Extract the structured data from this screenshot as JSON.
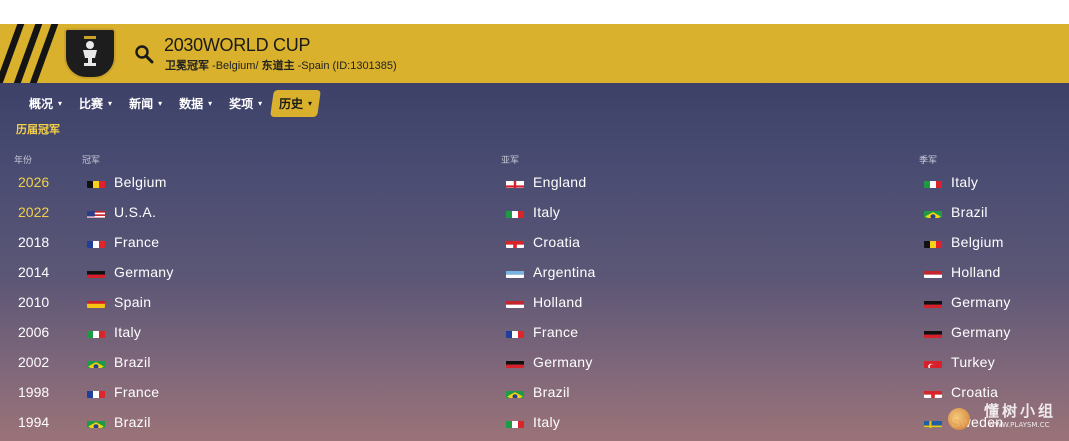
{
  "header": {
    "title": "2030WORLD CUP",
    "subtitle_label1": "卫冕冠军",
    "subtitle_value1": " -Belgium/ ",
    "subtitle_label2": "东道主",
    "subtitle_value2": " -Spain (ID:1301385)"
  },
  "nav": [
    {
      "label": "概况",
      "active": false
    },
    {
      "label": "比赛",
      "active": false
    },
    {
      "label": "新闻",
      "active": false
    },
    {
      "label": "数据",
      "active": false
    },
    {
      "label": "奖项",
      "active": false
    },
    {
      "label": "历史",
      "active": true
    }
  ],
  "section_title": "历届冠军",
  "columns": {
    "year": "年份",
    "champion": "冠军",
    "runner_up": "亚军",
    "third": "季军"
  },
  "rows": [
    {
      "year": "2026",
      "highlight": true,
      "champion": {
        "name": "Belgium",
        "flag": "be"
      },
      "runner_up": {
        "name": "England",
        "flag": "en"
      },
      "third": {
        "name": "Italy",
        "flag": "it"
      }
    },
    {
      "year": "2022",
      "highlight": true,
      "champion": {
        "name": "U.S.A.",
        "flag": "us"
      },
      "runner_up": {
        "name": "Italy",
        "flag": "it"
      },
      "third": {
        "name": "Brazil",
        "flag": "br"
      }
    },
    {
      "year": "2018",
      "highlight": false,
      "champion": {
        "name": "France",
        "flag": "fr"
      },
      "runner_up": {
        "name": "Croatia",
        "flag": "hr"
      },
      "third": {
        "name": "Belgium",
        "flag": "be"
      }
    },
    {
      "year": "2014",
      "highlight": false,
      "champion": {
        "name": "Germany",
        "flag": "de"
      },
      "runner_up": {
        "name": "Argentina",
        "flag": "ar"
      },
      "third": {
        "name": "Holland",
        "flag": "nl"
      }
    },
    {
      "year": "2010",
      "highlight": false,
      "champion": {
        "name": "Spain",
        "flag": "es"
      },
      "runner_up": {
        "name": "Holland",
        "flag": "nl"
      },
      "third": {
        "name": "Germany",
        "flag": "de"
      }
    },
    {
      "year": "2006",
      "highlight": false,
      "champion": {
        "name": "Italy",
        "flag": "it"
      },
      "runner_up": {
        "name": "France",
        "flag": "fr"
      },
      "third": {
        "name": "Germany",
        "flag": "de"
      }
    },
    {
      "year": "2002",
      "highlight": false,
      "champion": {
        "name": "Brazil",
        "flag": "br"
      },
      "runner_up": {
        "name": "Germany",
        "flag": "de"
      },
      "third": {
        "name": "Turkey",
        "flag": "tr"
      }
    },
    {
      "year": "1998",
      "highlight": false,
      "champion": {
        "name": "France",
        "flag": "fr"
      },
      "runner_up": {
        "name": "Brazil",
        "flag": "br"
      },
      "third": {
        "name": "Croatia",
        "flag": "hr"
      }
    },
    {
      "year": "1994",
      "highlight": false,
      "champion": {
        "name": "Brazil",
        "flag": "br"
      },
      "runner_up": {
        "name": "Italy",
        "flag": "it"
      },
      "third": {
        "name": "Sweden",
        "flag": "se"
      }
    }
  ],
  "watermark": {
    "text": "懂树小组",
    "url": "WWW.PLAYSM.CC"
  },
  "colors": {
    "accent": "#d9b12c",
    "highlight_year": "#f2d04a"
  }
}
